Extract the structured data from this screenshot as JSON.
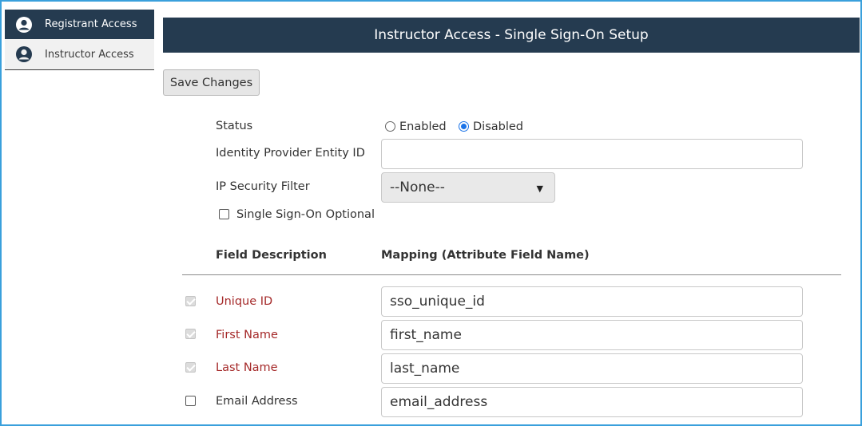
{
  "sidebar": {
    "items": [
      {
        "label": "Registrant Access",
        "icon": "user-icon",
        "active": true
      },
      {
        "label": "Instructor Access",
        "icon": "user-icon",
        "active": false
      }
    ]
  },
  "header": {
    "title": "Instructor Access - Single Sign-On Setup"
  },
  "toolbar": {
    "save_label": "Save Changes"
  },
  "form": {
    "status_label": "Status",
    "status_options": [
      "Enabled",
      "Disabled"
    ],
    "status_selected": "Disabled",
    "idp_label": "Identity Provider Entity ID",
    "idp_value": "",
    "ip_filter_label": "IP Security Filter",
    "ip_filter_value": "--None--",
    "sso_optional_label": "Single Sign-On Optional"
  },
  "mapping": {
    "col_description": "Field Description",
    "col_mapping": "Mapping (Attribute Field Name)",
    "rows": [
      {
        "label": "Unique ID",
        "value": "sso_unique_id",
        "required": true
      },
      {
        "label": "First Name",
        "value": "first_name",
        "required": true
      },
      {
        "label": "Last Name",
        "value": "last_name",
        "required": true
      },
      {
        "label": "Email Address",
        "value": "email_address",
        "required": false
      }
    ]
  },
  "colors": {
    "header_bg": "#253b50",
    "required_label": "#a52a2a",
    "border_accent": "#3aa0dc"
  }
}
